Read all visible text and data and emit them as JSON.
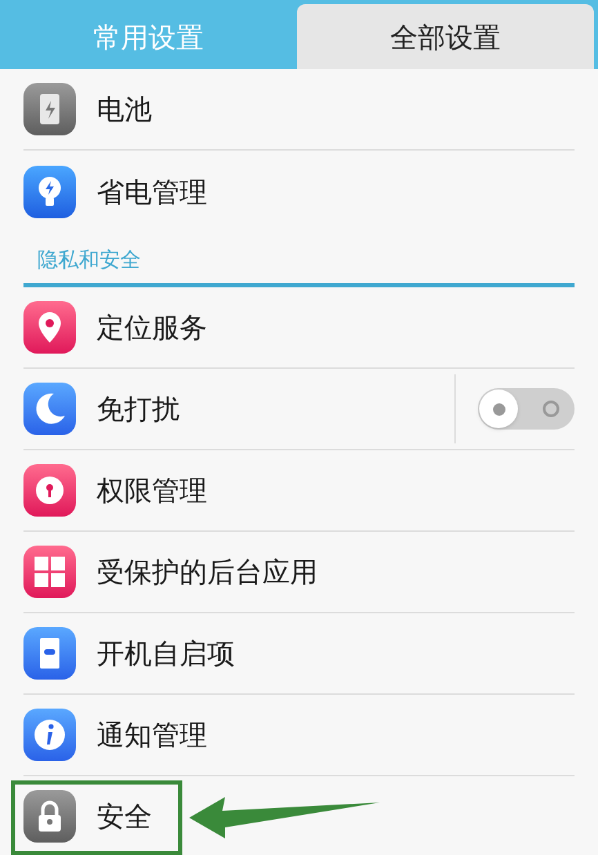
{
  "tabs": [
    {
      "label": "常用设置",
      "selected": false
    },
    {
      "label": "全部设置",
      "selected": true
    }
  ],
  "groups": [
    {
      "items": [
        {
          "kind": "link",
          "label": "电池"
        },
        {
          "kind": "link",
          "label": "省电管理"
        }
      ]
    },
    {
      "header": "隐私和安全",
      "items": [
        {
          "kind": "link",
          "label": "定位服务"
        },
        {
          "kind": "toggle",
          "label": "免打扰",
          "on": false
        },
        {
          "kind": "link",
          "label": "权限管理"
        },
        {
          "kind": "link",
          "label": "受保护的后台应用"
        },
        {
          "kind": "link",
          "label": "开机自启项"
        },
        {
          "kind": "link",
          "label": "通知管理"
        },
        {
          "kind": "link",
          "label": "安全",
          "highlighted": true
        }
      ]
    }
  ]
}
